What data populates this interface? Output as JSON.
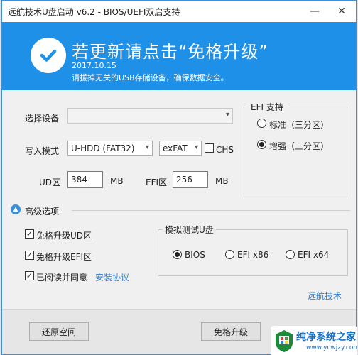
{
  "window": {
    "title": "远航技术U盘启动 v6.2 - BIOS/UEFI双启支持",
    "minimize": "—",
    "close": "✕"
  },
  "banner": {
    "title": "若更新请点击“免格升级”",
    "date": "2017.10.15",
    "note": "请拔掉无关的USB存储设备，确保数据安全。",
    "color": "#1e90e8"
  },
  "form": {
    "select_device_label": "选择设备",
    "select_device_value": "",
    "write_mode_label": "写入模式",
    "write_mode_value": "U-HDD (FAT32)",
    "fs_value": "exFAT",
    "chs_label": "CHS",
    "chs_checked": false,
    "ud_label": "UD区",
    "ud_value": "384",
    "ud_unit": "MB",
    "efi_label": "EFI区",
    "efi_value": "256",
    "efi_unit": "MB"
  },
  "efi_group": {
    "title": "EFI 支持",
    "options": [
      {
        "label": "标准（三分区）",
        "selected": false
      },
      {
        "label": "增强（三分区）",
        "selected": true
      }
    ]
  },
  "advanced": {
    "title": "高级选项",
    "checkboxes": [
      {
        "label": "免格升级UD区",
        "checked": true
      },
      {
        "label": "免格升级EFI区",
        "checked": true
      },
      {
        "label": "已阅读并同意",
        "checked": true
      }
    ],
    "agreement_link": "安装协议"
  },
  "sim_group": {
    "title": "模拟测试U盘",
    "options": [
      {
        "label": "BIOS",
        "selected": true
      },
      {
        "label": "EFI x86",
        "selected": false
      },
      {
        "label": "EFI x64",
        "selected": false
      }
    ]
  },
  "brand_link": "远航技术",
  "footer": {
    "restore_button": "还原空间",
    "upgrade_button": "免格升级"
  },
  "watermark": {
    "main": "纯净系统之家",
    "sub": "www.ycwjzy.com"
  },
  "colors": {
    "accent": "#1e90e8",
    "link": "#2a7fd4"
  }
}
